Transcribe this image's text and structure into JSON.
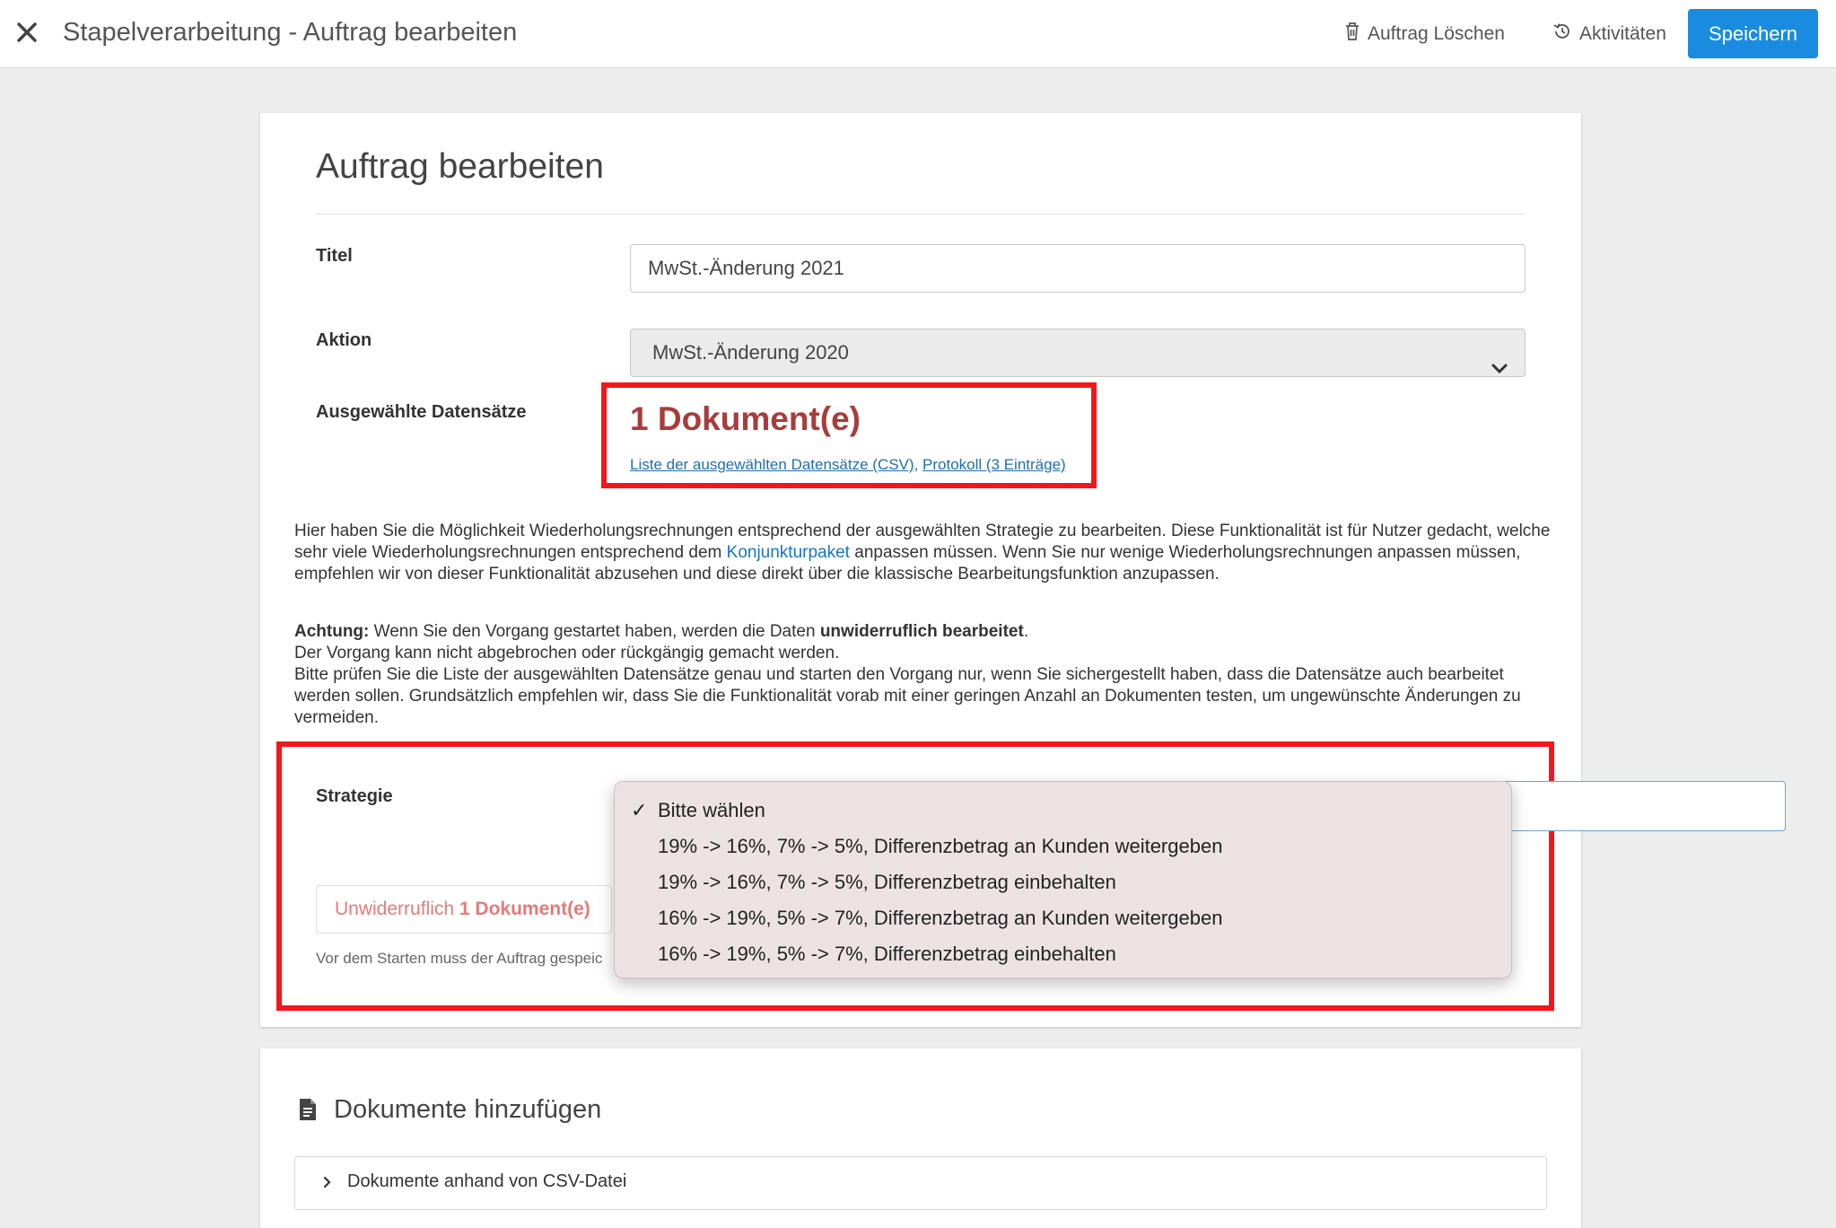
{
  "topbar": {
    "title": "Stapelverarbeitung - Auftrag bearbeiten",
    "delete_label": "Auftrag Löschen",
    "activity_label": "Aktivitäten",
    "save_label": "Speichern"
  },
  "form": {
    "heading": "Auftrag bearbeiten",
    "title_label": "Titel",
    "title_value": "MwSt.-Änderung 2021",
    "action_label": "Aktion",
    "action_value": "MwSt.-Änderung 2020",
    "selected_label": "Ausgewählte Datensätze",
    "doc_count": "1 Dokument(e)",
    "link_list": "Liste der ausgewählten Datensätze (CSV)",
    "link_sep": ", ",
    "link_protocol": "Protokoll (3 Einträge)"
  },
  "info": {
    "p1_a": "Hier haben Sie die Möglichkeit Wiederholungsrechnungen entsprechend der ausgewählten Strategie zu bearbeiten. Diese Funktionalität ist für Nutzer gedacht, welche sehr viele Wiederholungsrechnungen entsprechend dem ",
    "p1_link": "Konjunkturpaket",
    "p1_b": " anpassen müssen. Wenn Sie nur wenige Wiederholungsrechnungen anpassen müssen, empfehlen wir von dieser Funktionalität abzusehen und diese direkt über die klassische Bearbeitungsfunktion anzupassen.",
    "p2_bold": "Achtung:",
    "p2_a": " Wenn Sie den Vorgang gestartet haben, werden die Daten ",
    "p2_bold2": "unwiderruflich bearbeitet",
    "p2_b": ".",
    "p2_line2": "Der Vorgang kann nicht abgebrochen oder rückgängig gemacht werden.",
    "p2_line3": "Bitte prüfen Sie die Liste der ausgewählten Datensätze genau und starten den Vorgang nur, wenn Sie sichergestellt haben, dass die Datensätze auch bearbeitet werden sollen. Grundsätzlich empfehlen wir, dass Sie die Funktionalität vorab mit einer geringen Anzahl an Dokumenten testen, um ungewünschte Änderungen zu vermeiden."
  },
  "strategy": {
    "label": "Strategie",
    "button_prefix": "Unwiderruflich ",
    "button_count": "1 Dokument(e)",
    "hint": "Vor dem Starten muss der Auftrag gespeic",
    "options": [
      "Bitte wählen",
      "19% -> 16%, 7% -> 5%, Differenzbetrag an Kunden weitergeben",
      "19% -> 16%, 7% -> 5%, Differenzbetrag einbehalten",
      "16% -> 19%, 5% -> 7%, Differenzbetrag an Kunden weitergeben",
      "16% -> 19%, 5% -> 7%, Differenzbetrag einbehalten"
    ],
    "selected_check": "✓"
  },
  "docs": {
    "heading": "Dokumente hinzufügen",
    "accordion_label": "Dokumente anhand von CSV-Datei"
  },
  "colors": {
    "primary": "#1a8ce0",
    "danger_text": "#a83c3c",
    "highlight_box": "#f3171b",
    "link": "#1f6fb0"
  }
}
